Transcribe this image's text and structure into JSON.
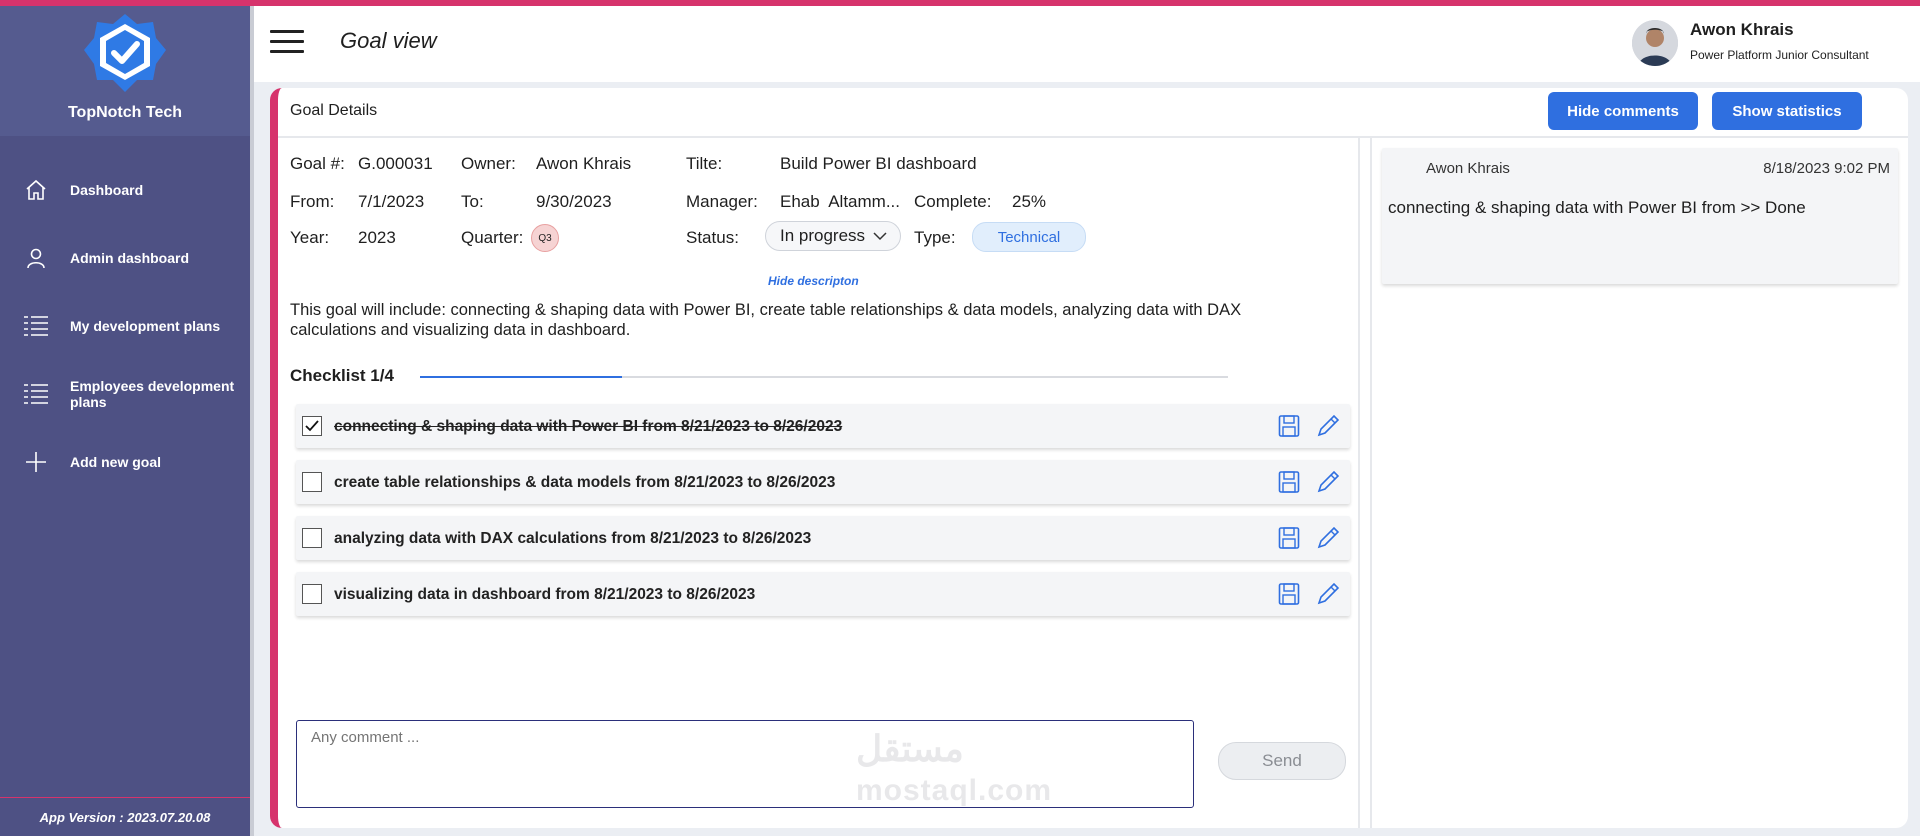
{
  "colors": {
    "accent": "#d6336c",
    "primary": "#2f6fe0",
    "sidebar": "#4e5184"
  },
  "sidebar": {
    "brand_name": "TopNotch Tech",
    "items": [
      {
        "label": "Dashboard",
        "icon": "home-icon"
      },
      {
        "label": "Admin dashboard",
        "icon": "user-icon"
      },
      {
        "label": "My development plans",
        "icon": "list-icon"
      },
      {
        "label": "Employees development plans",
        "icon": "list-icon"
      },
      {
        "label": "Add new goal",
        "icon": "plus-icon"
      }
    ],
    "version": "App Version : 2023.07.20.08"
  },
  "header": {
    "title": "Goal view",
    "user_name": "Awon Khrais",
    "user_role": "Power Platform Junior Consultant"
  },
  "card": {
    "title": "Goal Details",
    "hide_comments": "Hide comments",
    "show_statistics": "Show statistics"
  },
  "goal": {
    "goal_no_label": "Goal #:",
    "goal_no": "G.000031",
    "owner_label": "Owner:",
    "owner": "Awon Khrais",
    "title_label": "Tilte:",
    "title": "Build Power BI dashboard",
    "from_label": "From:",
    "from": "7/1/2023",
    "to_label": "To:",
    "to": "9/30/2023",
    "manager_label": "Manager:",
    "manager": "Ehab  Altamm...",
    "complete_label": "Complete:",
    "complete": "25%",
    "year_label": "Year:",
    "year": "2023",
    "quarter_label": "Quarter:",
    "quarter": "Q3",
    "status_label": "Status:",
    "status": "In progress",
    "type_label": "Type:",
    "type": "Technical",
    "hide_description": "Hide descripton",
    "description": "This goal will include: connecting & shaping data with Power BI, create table relationships & data models, analyzing data with DAX calculations and visualizing data in dashboard."
  },
  "checklist": {
    "title": "Checklist 1/4",
    "progress": 0.25,
    "items": [
      {
        "text": "connecting & shaping data with Power BI from 8/21/2023 to 8/26/2023",
        "checked": true
      },
      {
        "text": "create table relationships & data models from 8/21/2023 to 8/26/2023",
        "checked": false
      },
      {
        "text": "analyzing data with DAX calculations from 8/21/2023 to 8/26/2023",
        "checked": false
      },
      {
        "text": "visualizing data in dashboard from 8/21/2023 to 8/26/2023",
        "checked": false
      }
    ]
  },
  "comment_input": {
    "placeholder": "Any comment ...",
    "send_label": "Send"
  },
  "watermark": {
    "ar": "مستقل",
    "en": "mostaql.com"
  },
  "comments": [
    {
      "author": "Awon Khrais",
      "date": "8/18/2023 9:02 PM",
      "text": "connecting & shaping data with Power BI from >> Done"
    }
  ]
}
